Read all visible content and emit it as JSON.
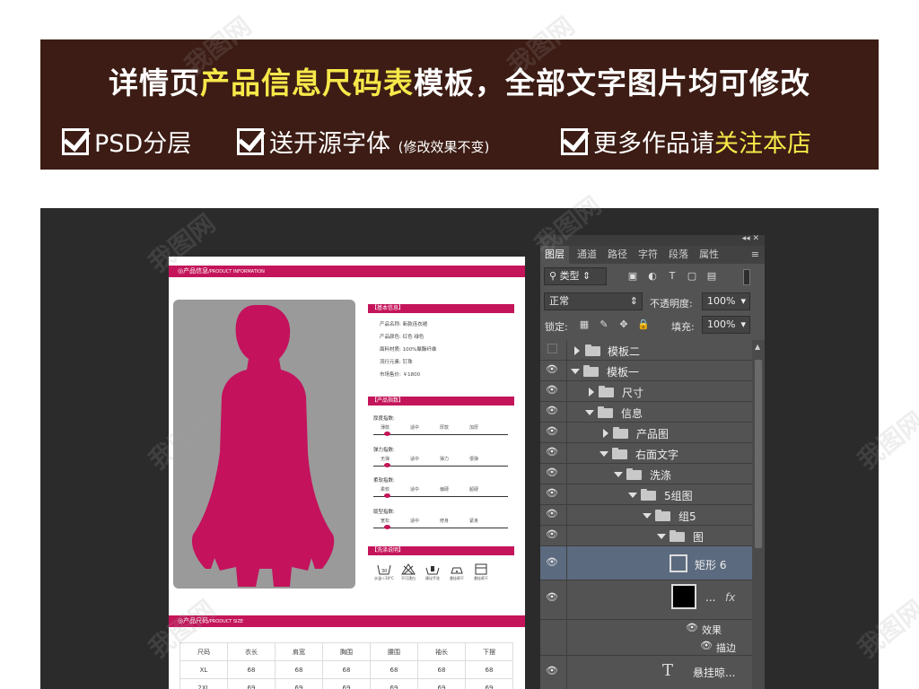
{
  "banner": {
    "title_pre": "详情页",
    "title_hl": "产品信息尺码表",
    "title_post": "模板，全部文字图片均可修改",
    "item1": "PSD分层",
    "item2": "送开源字体",
    "item2_note": "(修改效果不变)",
    "item3_pre": "更多作品请",
    "item3_hl": "关注本店"
  },
  "doc": {
    "sec_info": "◎产品信息",
    "sec_info_en": "/PRODUCT INFORMATION",
    "basic_title": "【基本信息】",
    "basic": [
      "产品名称: 新款连衣裙",
      "产品颜色: 红色 绿色",
      "面料材质: 100%聚酯纤维",
      "流行元素: 钉珠",
      "市场售价: ￥1800"
    ],
    "index_title": "【产品指数】",
    "indices": [
      {
        "label": "厚度指数:",
        "opts": [
          "薄款",
          "适中",
          "厚款",
          "加厚"
        ],
        "level": 0.08
      },
      {
        "label": "弹力指数:",
        "opts": [
          "无弹",
          "适中",
          "弹力",
          "很弹"
        ],
        "level": 0.08
      },
      {
        "label": "柔软指数:",
        "opts": [
          "柔软",
          "适中",
          "偏硬",
          "超硬"
        ],
        "level": 0.08
      },
      {
        "label": "版型指数:",
        "opts": [
          "宽松",
          "适中",
          "修身",
          "紧身"
        ],
        "level": 0.08
      }
    ],
    "wash_title": "【洗涤说明】",
    "wash": [
      "水温＜30°C",
      "不可漂白",
      "建议手洗",
      "悬挂晾干",
      "悬挂晾干"
    ],
    "sec_size": "◎产品尺码",
    "sec_size_en": "/PRODUCT SIZE",
    "size_header": [
      "尺码",
      "衣长",
      "肩宽",
      "胸围",
      "腰围",
      "袖长",
      "下摆"
    ],
    "size_rows": [
      [
        "XL",
        "68",
        "68",
        "68",
        "68",
        "68",
        "68"
      ],
      [
        "2XL",
        "69",
        "69",
        "69",
        "69",
        "69",
        "69"
      ]
    ]
  },
  "panel": {
    "tabs": [
      "图层",
      "通道",
      "路径",
      "字符",
      "段落",
      "属性"
    ],
    "kind_label": "类型",
    "blend_mode": "正常",
    "opacity_label": "不透明度:",
    "opacity": "100%",
    "lock_label": "锁定:",
    "fill_label": "填充:",
    "fill": "100%",
    "layers": [
      {
        "name": "模板二",
        "type": "folder",
        "open": false,
        "eye": false
      },
      {
        "name": "模板一",
        "type": "folder",
        "open": true,
        "eye": true
      },
      {
        "name": "尺寸",
        "type": "folder",
        "open": false,
        "eye": true
      },
      {
        "name": "信息",
        "type": "folder",
        "open": true,
        "eye": true
      },
      {
        "name": "产品图",
        "type": "folder",
        "open": false,
        "eye": true
      },
      {
        "name": "右面文字",
        "type": "folder",
        "open": true,
        "eye": true
      },
      {
        "name": "洗涤",
        "type": "folder",
        "open": true,
        "eye": true
      },
      {
        "name": "5组图",
        "type": "folder",
        "open": true,
        "eye": true
      },
      {
        "name": "组5",
        "type": "folder",
        "open": true,
        "eye": true
      },
      {
        "name": "图",
        "type": "folder",
        "open": true,
        "eye": true
      },
      {
        "name": "矩形 6",
        "type": "shape",
        "eye": true,
        "selected": true
      },
      {
        "name": "...",
        "type": "fx",
        "eye": true
      },
      {
        "name": "效果",
        "type": "effect"
      },
      {
        "name": "描边",
        "type": "effect"
      },
      {
        "name": "悬挂晾...",
        "type": "text",
        "eye": true
      }
    ],
    "fx_label": "fx"
  },
  "watermark": "我图网",
  "colors": {
    "brand": "#c4155a",
    "banner": "#3c1c14",
    "highlight": "#f6e84a"
  }
}
